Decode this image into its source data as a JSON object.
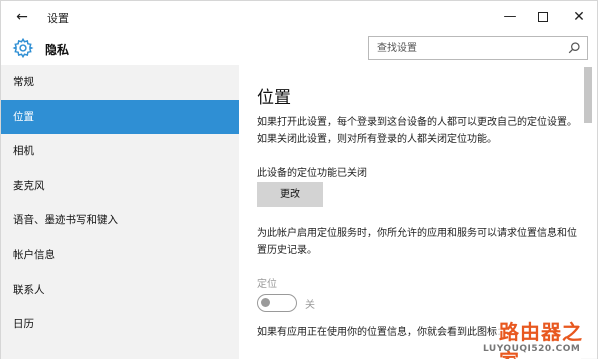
{
  "window": {
    "title": "设置",
    "back_glyph": "←",
    "min_glyph": "—",
    "close_glyph": "✕"
  },
  "header": {
    "title": "隐私",
    "icon": "gear-icon",
    "search": {
      "placeholder": "查找设置",
      "value": "",
      "icon": "search-icon"
    }
  },
  "sidebar": {
    "items": [
      {
        "label": "常规",
        "selected": false
      },
      {
        "label": "位置",
        "selected": true
      },
      {
        "label": "相机",
        "selected": false
      },
      {
        "label": "麦克风",
        "selected": false
      },
      {
        "label": "语音、墨迹书写和键入",
        "selected": false
      },
      {
        "label": "帐户信息",
        "selected": false
      },
      {
        "label": "联系人",
        "selected": false
      },
      {
        "label": "日历",
        "selected": false
      }
    ]
  },
  "main": {
    "title": "位置",
    "description1": "如果打开此设置，每个登录到这台设备的人都可以更改自己的定位设置。如果关闭此设置，则对所有登录的人都关闭定位功能。",
    "device_status": "此设备的定位功能已关闭",
    "change_button": "更改",
    "description2": "为此帐户启用定位服务时，你所允许的应用和服务可以请求位置信息和位置历史记录。",
    "location_label": "定位",
    "toggle_state": "关",
    "toggle_on": false,
    "description3": "如果有应用正在使用你的位置信息，你就会看到此图标："
  },
  "watermark": {
    "text": "路由器之家",
    "url": "LUYOUQI520.COM"
  },
  "colors": {
    "accent": "#2f8fd4",
    "sidebar_bg": "#f2f2f2",
    "button_bg": "#d3d3d3",
    "disabled_text": "#9a9a9a",
    "watermark": "#e8581f"
  }
}
